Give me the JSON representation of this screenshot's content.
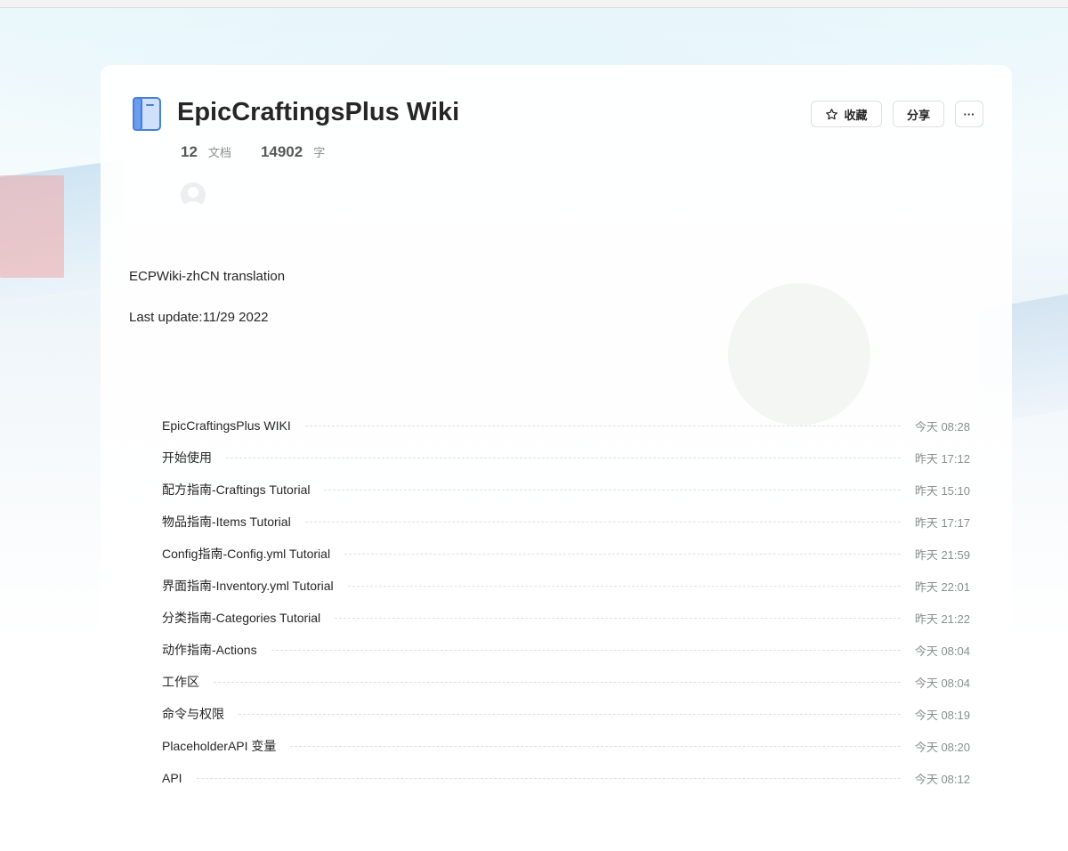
{
  "book": {
    "title": "EpicCraftingsPlus Wiki",
    "doc_count": "12",
    "doc_label": "文档",
    "word_count": "14902",
    "word_label": "字"
  },
  "actions": {
    "favorite_label": "收藏",
    "share_label": "分享",
    "more_label": "···"
  },
  "description": {
    "line1": "ECPWiki-zhCN translation",
    "line2": "Last update:11/29 2022"
  },
  "toc": [
    {
      "title": "EpicCraftingsPlus WIKI",
      "time": "今天 08:28"
    },
    {
      "title": "开始使用",
      "time": "昨天 17:12"
    },
    {
      "title": "配方指南-Craftings Tutorial",
      "time": "昨天 15:10"
    },
    {
      "title": "物品指南-Items Tutorial",
      "time": "昨天 17:17"
    },
    {
      "title": "Config指南-Config.yml Tutorial",
      "time": "昨天 21:59"
    },
    {
      "title": "界面指南-Inventory.yml Tutorial",
      "time": "昨天 22:01"
    },
    {
      "title": "分类指南-Categories Tutorial",
      "time": "昨天 21:22"
    },
    {
      "title": "动作指南-Actions",
      "time": "今天 08:04"
    },
    {
      "title": "工作区",
      "time": "今天 08:04"
    },
    {
      "title": "命令与权限",
      "time": "今天 08:19"
    },
    {
      "title": "PlaceholderAPI 变量",
      "time": "今天 08:20"
    },
    {
      "title": "API",
      "time": "今天 08:12"
    }
  ],
  "colors": {
    "book_icon": "#6b9cf0",
    "text_primary": "#262626",
    "text_secondary": "#8a8f8d"
  },
  "icons": {
    "book": "book-icon",
    "favorite": "star-outline-icon",
    "more": "more-dots-icon",
    "avatar": "user-avatar"
  }
}
